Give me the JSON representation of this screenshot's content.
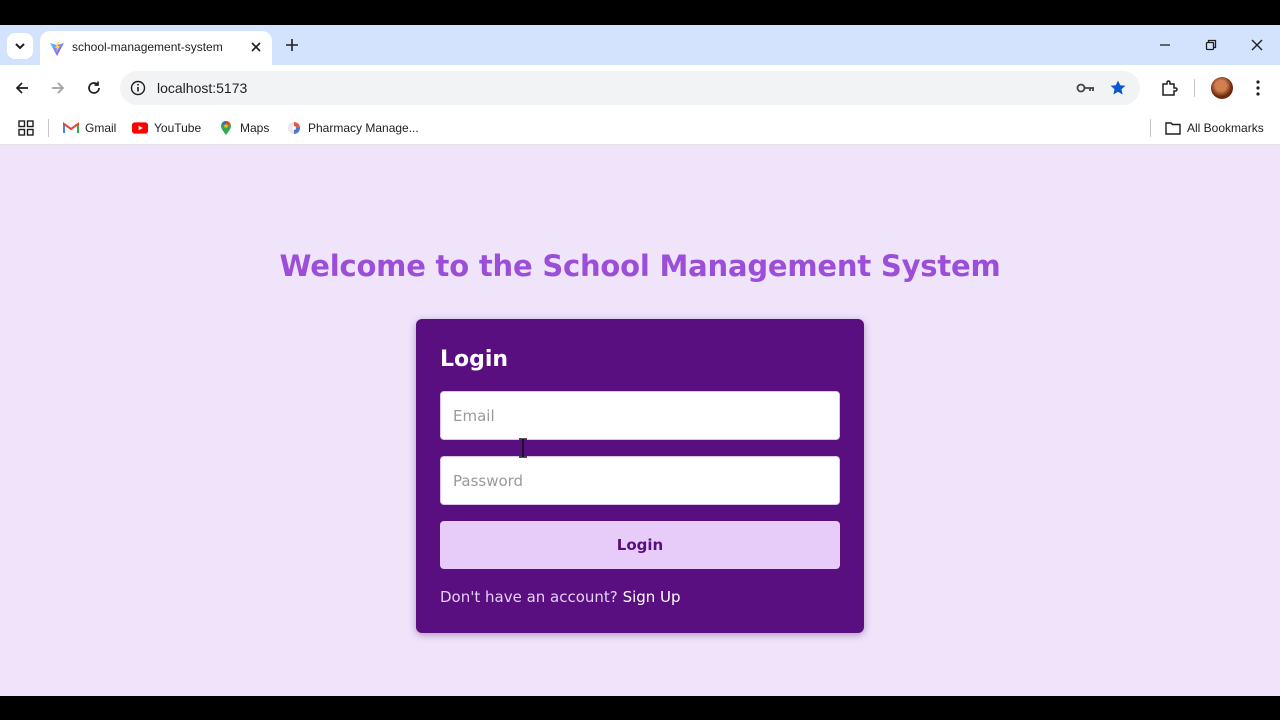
{
  "browser": {
    "tab": {
      "title": "school-management-system",
      "favicon": "vite-logo-icon"
    },
    "address": {
      "url": "localhost:5173"
    },
    "bookmarks": [
      {
        "label": "Gmail",
        "icon": "gmail-icon"
      },
      {
        "label": "YouTube",
        "icon": "youtube-icon"
      },
      {
        "label": "Maps",
        "icon": "maps-icon"
      },
      {
        "label": "Pharmacy Manage...",
        "icon": "site-icon"
      }
    ],
    "all_bookmarks_label": "All Bookmarks",
    "bookmark_star_color": "#0b57d0"
  },
  "page": {
    "heading": "Welcome to the School Management System",
    "login_card": {
      "title": "Login",
      "email_placeholder": "Email",
      "password_placeholder": "Password",
      "submit_label": "Login",
      "signup_prompt": "Don't have an account?",
      "signup_link": "Sign Up"
    }
  },
  "colors": {
    "page_bg": "#f0e4fb",
    "heading": "#9b4fd8",
    "card_bg": "#5a0f80",
    "button_bg": "#e7cbf8"
  }
}
